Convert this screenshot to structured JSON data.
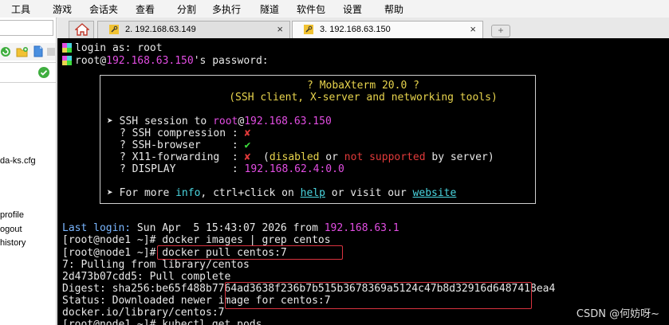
{
  "menu": [
    "工具",
    "游戏",
    "会话夹",
    "查看",
    "分割",
    "多执行",
    "隧道",
    "软件包",
    "设置",
    "帮助"
  ],
  "left_pane": {
    "files": [
      "da-ks.cfg",
      "profile",
      "ogout",
      "history"
    ]
  },
  "tabs": [
    {
      "label": "2. 192.168.63.149",
      "active": false
    },
    {
      "label": "3. 192.168.63.150",
      "active": true
    }
  ],
  "tab_close": "×",
  "new_tab": "+",
  "terminal": {
    "login": "login as: root",
    "password_user": "root@",
    "password_host": "192.168.63.150",
    "password_suffix": "'s password:",
    "banner": {
      "title": "? MobaXterm 20.0 ?",
      "subtitle": "(SSH client, X-server and networking tools)",
      "session_prefix": "SSH session to ",
      "session_user": "root",
      "session_at": "@",
      "session_host": "192.168.63.150",
      "compression_label": "? SSH compression : ",
      "compression_value": "✘",
      "browser_label": "? SSH-browser     : ",
      "browser_value": "✔",
      "x11_label": "? X11-forwarding  : ",
      "x11_value": "✘",
      "x11_note_open": "  (",
      "x11_disabled": "disabled",
      "x11_or": " or ",
      "x11_notsupported": "not supported",
      "x11_by": " by server)",
      "display_label": "? DISPLAY         : ",
      "display_value": "192.168.62.4:0.0",
      "info_prefix": "For more ",
      "info_word": "info",
      "info_mid": ", ctrl+click on ",
      "help_word": "help",
      "info_mid2": " or visit our ",
      "website_word": "website"
    },
    "last_login_label": "Last login:",
    "last_login_text": " Sun Apr  5 15:43:07 2026 from ",
    "last_login_host": "192.168.63.1",
    "lines": [
      "[root@node1 ~]# docker images | grep centos",
      "[root@node1 ~]# docker pull centos:7",
      "7: Pulling from library/centos",
      "2d473b07cdd5: Pull complete",
      "Digest: sha256:be65f488b7764ad3638f236b7b515b3678369a5124c47b8d32916d6487418ea4",
      "Status: Downloaded newer image for centos:7",
      "docker.io/library/centos:7",
      "[root@node1 ~]# kubectl get pods"
    ]
  },
  "watermark": "CSDN @何妨呀~",
  "colors": {
    "terminal_bg": "#000000",
    "magenta": "#e24de2",
    "yellow": "#e8d44d",
    "red": "#e23a3a",
    "green": "#3ddc3d",
    "cyan": "#4ad6e0",
    "highlight_box": "#d9333f"
  }
}
